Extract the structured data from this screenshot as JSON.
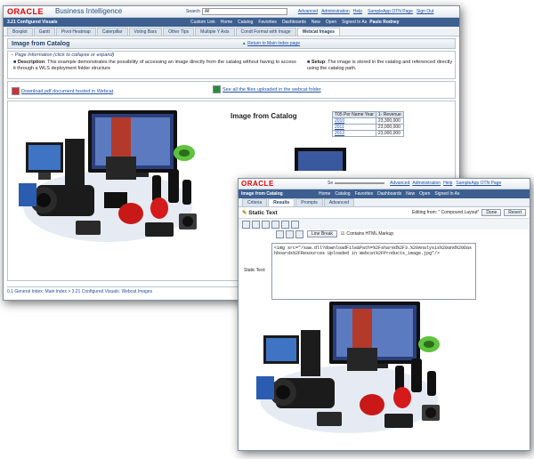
{
  "main": {
    "logo": "ORACLE",
    "product": "Business Intelligence",
    "dashboard_title": "3.21 Configured Visuals",
    "nav": {
      "search_label": "Search",
      "search_scope": "All",
      "links": [
        "Advanced",
        "Administration",
        "Help"
      ],
      "sample_app": "SampleApp OTN Page",
      "sign_out": "Sign Out",
      "menu": [
        "Custom Link",
        "Home",
        "Catalog",
        "Favorites",
        "Dashboards",
        "New",
        "Open",
        "Signed In As"
      ],
      "user": "Paulo Rodney"
    },
    "tabs": [
      "Boxplot",
      "Gantt",
      "Pivot Heatmap",
      "Caterpillar",
      "Voting Bars",
      "Other Tips",
      "Multiple Y Axis",
      "Condt Format with Image",
      "Webcat Images"
    ],
    "section_title": "Image from Catalog",
    "return_link": "Return to Main Index page",
    "page_info_toggle": "Page Information (click to collapse or expand)",
    "description_label": "Description",
    "description_text": ": This example demonstrates the possibility of accessing an image directly from the catalog without having to access it through a WLS deployment folder structure",
    "setup_label": "Setup",
    "setup_text": ": The image is stored in the catalog and referenced directly using the catalog path.",
    "download_link": "Download pdf document hosted in Webcat",
    "see_all_link": "See all the files uploaded in the webcat folder",
    "content_heading": "Image from Catalog",
    "table": {
      "headers": [
        "T05 Per Name Year",
        "1- Revenue"
      ],
      "rows": [
        [
          "2010",
          "23,300,000"
        ],
        [
          "2011",
          "23,000,000"
        ],
        [
          "2012",
          "23,000,000"
        ]
      ]
    },
    "breadcrumb": "0.1 General Index: Main Index  >  3.21 Configured Visuals: Webcat Images"
  },
  "editor": {
    "logo": "ORACLE",
    "search_label": "Se",
    "links": [
      "Advanced",
      "Administration",
      "Help"
    ],
    "sample_app": "SampleApp OTN Page",
    "title": "Image from Catalog",
    "menu": [
      "Home",
      "Catalog",
      "Favorites",
      "Dashboards",
      "New",
      "Open",
      "Signed In As"
    ],
    "tabs": [
      "Criteria",
      "Results",
      "Prompts",
      "Advanced"
    ],
    "view_title": "Static Text",
    "editing_from": "Editing from: \" Compound Layout\"",
    "done_button": "Done",
    "revert_button": "Revert",
    "line_break": "Line Break",
    "contains_html": "Contains HTML Markup",
    "static_text_label": "Static Text:",
    "static_text_value": "<img src=\"/saw.dll?downloadFile&Path=%2Fshared%2F3.%20Analysis%20and%20Dashboards%2FResources Uploaded in Webcat%2FProducts_image.jpg\"/>"
  }
}
